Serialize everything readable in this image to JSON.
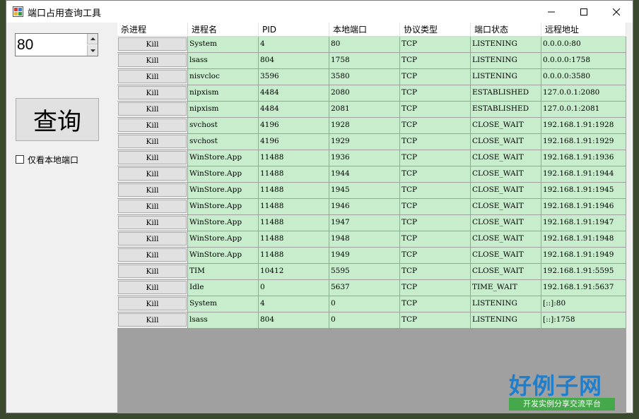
{
  "window": {
    "title": "端口占用查询工具"
  },
  "controls": {
    "port_value": "80",
    "query_label": "查询",
    "local_only_label": "仅看本地端口"
  },
  "grid": {
    "columns": [
      "杀进程",
      "进程名",
      "PID",
      "本地端口",
      "协议类型",
      "端口状态",
      "远程地址"
    ],
    "rows": [
      {
        "action": "Kill",
        "name": "System",
        "pid": "4",
        "port": "80",
        "proto": "TCP",
        "state": "LISTENING",
        "remote": "0.0.0.0:80"
      },
      {
        "action": "Kill",
        "name": "lsass",
        "pid": "804",
        "port": "1758",
        "proto": "TCP",
        "state": "LISTENING",
        "remote": "0.0.0.0:1758"
      },
      {
        "action": "Kill",
        "name": "nisvcloc",
        "pid": "3596",
        "port": "3580",
        "proto": "TCP",
        "state": "LISTENING",
        "remote": "0.0.0.0:3580"
      },
      {
        "action": "Kill",
        "name": "nipxism",
        "pid": "4484",
        "port": "2080",
        "proto": "TCP",
        "state": "ESTABLISHED",
        "remote": "127.0.0.1:2080"
      },
      {
        "action": "Kill",
        "name": "nipxism",
        "pid": "4484",
        "port": "2081",
        "proto": "TCP",
        "state": "ESTABLISHED",
        "remote": "127.0.0.1:2081"
      },
      {
        "action": "Kill",
        "name": "svchost",
        "pid": "4196",
        "port": "1928",
        "proto": "TCP",
        "state": "CLOSE_WAIT",
        "remote": "192.168.1.91:1928"
      },
      {
        "action": "Kill",
        "name": "svchost",
        "pid": "4196",
        "port": "1929",
        "proto": "TCP",
        "state": "CLOSE_WAIT",
        "remote": "192.168.1.91:1929"
      },
      {
        "action": "Kill",
        "name": "WinStore.App",
        "pid": "11488",
        "port": "1936",
        "proto": "TCP",
        "state": "CLOSE_WAIT",
        "remote": "192.168.1.91:1936"
      },
      {
        "action": "Kill",
        "name": "WinStore.App",
        "pid": "11488",
        "port": "1944",
        "proto": "TCP",
        "state": "CLOSE_WAIT",
        "remote": "192.168.1.91:1944"
      },
      {
        "action": "Kill",
        "name": "WinStore.App",
        "pid": "11488",
        "port": "1945",
        "proto": "TCP",
        "state": "CLOSE_WAIT",
        "remote": "192.168.1.91:1945"
      },
      {
        "action": "Kill",
        "name": "WinStore.App",
        "pid": "11488",
        "port": "1946",
        "proto": "TCP",
        "state": "CLOSE_WAIT",
        "remote": "192.168.1.91:1946"
      },
      {
        "action": "Kill",
        "name": "WinStore.App",
        "pid": "11488",
        "port": "1947",
        "proto": "TCP",
        "state": "CLOSE_WAIT",
        "remote": "192.168.1.91:1947"
      },
      {
        "action": "Kill",
        "name": "WinStore.App",
        "pid": "11488",
        "port": "1948",
        "proto": "TCP",
        "state": "CLOSE_WAIT",
        "remote": "192.168.1.91:1948"
      },
      {
        "action": "Kill",
        "name": "WinStore.App",
        "pid": "11488",
        "port": "1949",
        "proto": "TCP",
        "state": "CLOSE_WAIT",
        "remote": "192.168.1.91:1949"
      },
      {
        "action": "Kill",
        "name": "TIM",
        "pid": "10412",
        "port": "5595",
        "proto": "TCP",
        "state": "CLOSE_WAIT",
        "remote": "192.168.1.91:5595"
      },
      {
        "action": "Kill",
        "name": "Idle",
        "pid": "0",
        "port": "5637",
        "proto": "TCP",
        "state": "TIME_WAIT",
        "remote": "192.168.1.91:5637"
      },
      {
        "action": "Kill",
        "name": "System",
        "pid": "4",
        "port": "0",
        "proto": "TCP",
        "state": "LISTENING",
        "remote": "[::]:80"
      },
      {
        "action": "Kill",
        "name": "lsass",
        "pid": "804",
        "port": "0",
        "proto": "TCP",
        "state": "LISTENING",
        "remote": "[::]:1758"
      }
    ]
  },
  "watermark": {
    "brand": "好例子网",
    "tagline": "开发实例分享交流平台"
  },
  "colors": {
    "cell_background": "#c7edcc",
    "grid_background": "#a0a0a0",
    "brand_blue": "#1e7fcf",
    "brand_green": "#45a84a"
  }
}
